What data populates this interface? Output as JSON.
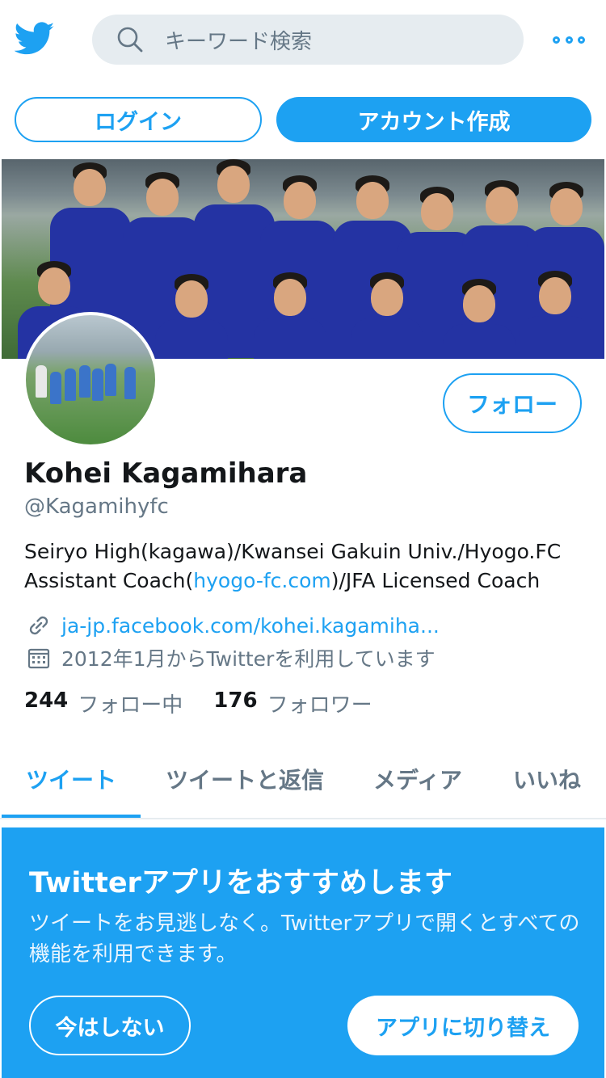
{
  "header": {
    "search_placeholder": "キーワード検索",
    "more_icon": "more-icon"
  },
  "auth": {
    "login_label": "ログイン",
    "signup_label": "アカウント作成"
  },
  "profile": {
    "name": "Kohei Kagamihara",
    "handle": "@Kagamihyfc",
    "bio_line1": "Seiryo High(kagawa)/Kwansei Gakuin Univ./Hyogo.FC",
    "bio_line2_pre": "Assistant Coach(",
    "bio_link": "hyogo-fc.com",
    "bio_line2_post": ")/JFA Licensed Coach",
    "website": "ja-jp.facebook.com/kohei.kagamiha...",
    "joined": "2012年1月からTwitterを利用しています",
    "following_count": "244",
    "following_label": "フォロー中",
    "followers_count": "176",
    "followers_label": "フォロワー",
    "follow_button": "フォロー"
  },
  "tabs": [
    {
      "label": "ツイート",
      "active": true
    },
    {
      "label": "ツイートと返信",
      "active": false
    },
    {
      "label": "メディア",
      "active": false
    },
    {
      "label": "いいね",
      "active": false
    }
  ],
  "promo": {
    "title": "Twitterアプリをおすすめします",
    "body": "ツイートをお見逃しなく。Twitterアプリで開くとすべての機能を利用できます。",
    "not_now": "今はしない",
    "switch": "アプリに切り替え"
  },
  "colors": {
    "accent": "#1da1f2",
    "text": "#14171a",
    "secondary": "#657786"
  }
}
